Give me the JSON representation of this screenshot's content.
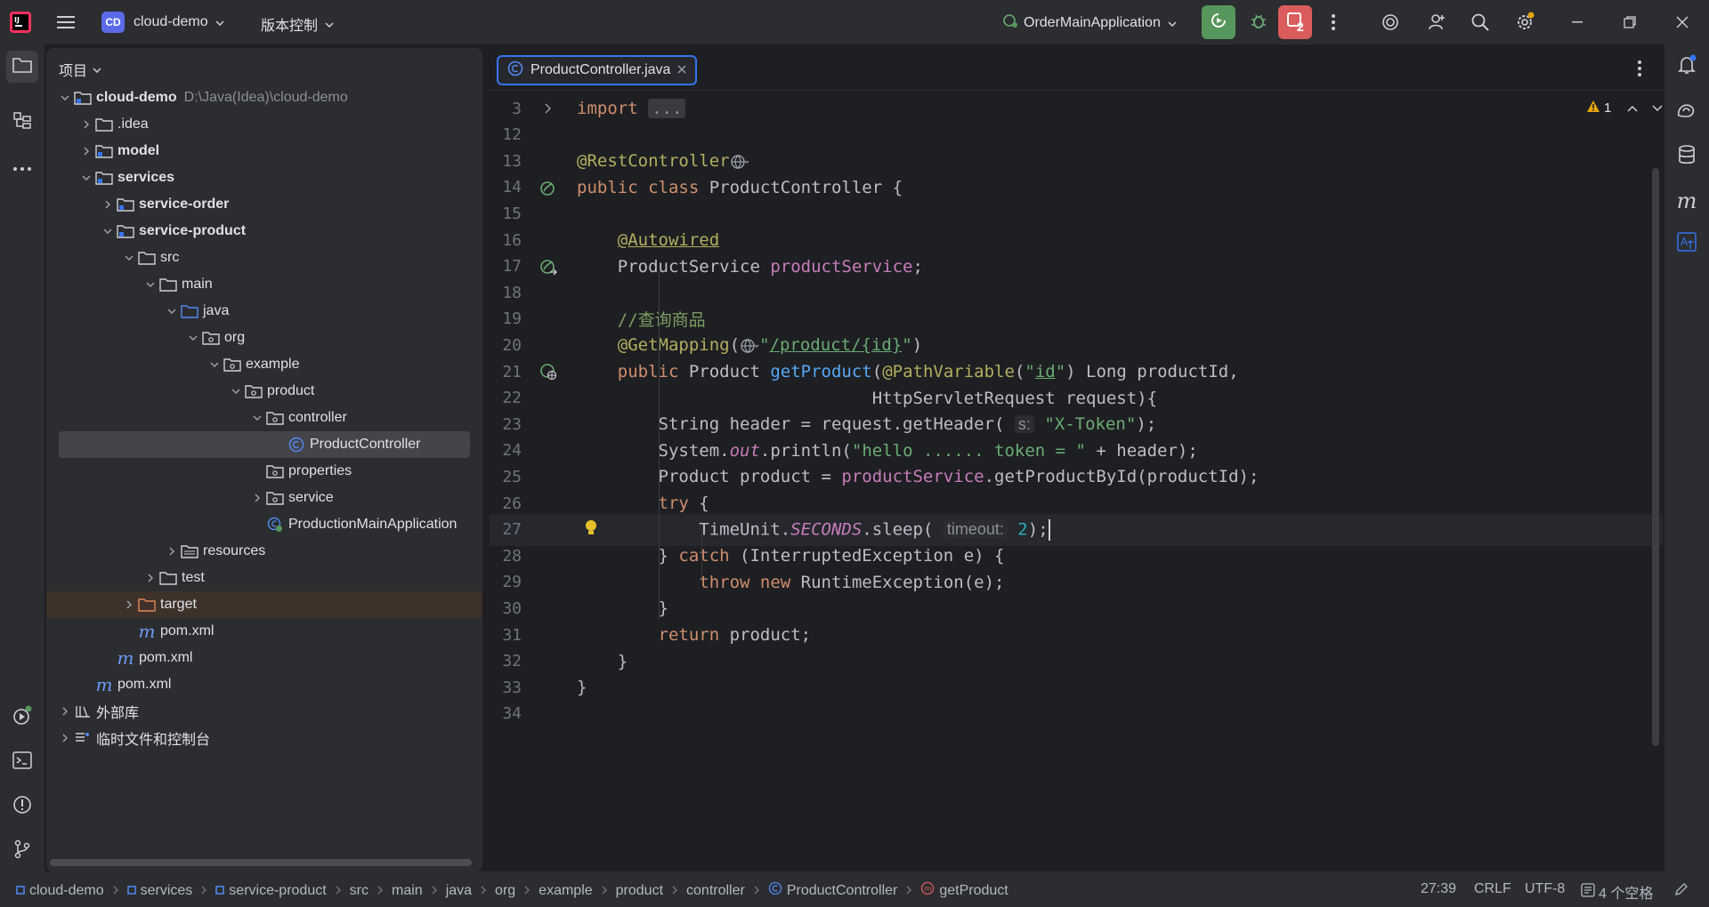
{
  "titlebar": {
    "project_badge": "CD",
    "project_name": "cloud-demo",
    "vcs_menu": "版本控制",
    "run_config": "OrderMainApplication",
    "run_badge_count": "2"
  },
  "project_panel": {
    "title": "项目",
    "tree": [
      {
        "label": "cloud-demo",
        "path": "D:\\Java(Idea)\\cloud-demo",
        "depth": 0,
        "chevron": "down",
        "icon": "module-folder",
        "bold": true
      },
      {
        "label": ".idea",
        "depth": 1,
        "chevron": "right",
        "icon": "folder"
      },
      {
        "label": "model",
        "depth": 1,
        "chevron": "right",
        "icon": "module-folder",
        "bold": true
      },
      {
        "label": "services",
        "depth": 1,
        "chevron": "down",
        "icon": "module-folder",
        "bold": true
      },
      {
        "label": "service-order",
        "depth": 2,
        "chevron": "right",
        "icon": "module-folder",
        "bold": true
      },
      {
        "label": "service-product",
        "depth": 2,
        "chevron": "down",
        "icon": "module-folder",
        "bold": true
      },
      {
        "label": "src",
        "depth": 3,
        "chevron": "down",
        "icon": "folder"
      },
      {
        "label": "main",
        "depth": 4,
        "chevron": "down",
        "icon": "folder"
      },
      {
        "label": "java",
        "depth": 5,
        "chevron": "down",
        "icon": "source-folder"
      },
      {
        "label": "org",
        "depth": 6,
        "chevron": "down",
        "icon": "package"
      },
      {
        "label": "example",
        "depth": 7,
        "chevron": "down",
        "icon": "package"
      },
      {
        "label": "product",
        "depth": 8,
        "chevron": "down",
        "icon": "package"
      },
      {
        "label": "controller",
        "depth": 9,
        "chevron": "down",
        "icon": "package"
      },
      {
        "label": "ProductController",
        "depth": 10,
        "chevron": "none",
        "icon": "class",
        "selected": true
      },
      {
        "label": "properties",
        "depth": 9,
        "chevron": "none",
        "icon": "package"
      },
      {
        "label": "service",
        "depth": 9,
        "chevron": "right",
        "icon": "package"
      },
      {
        "label": "ProductionMainApplication",
        "depth": 9,
        "chevron": "none",
        "icon": "spring-class"
      },
      {
        "label": "resources",
        "depth": 5,
        "chevron": "right",
        "icon": "resources-folder"
      },
      {
        "label": "test",
        "depth": 4,
        "chevron": "right",
        "icon": "folder"
      },
      {
        "label": "target",
        "depth": 3,
        "chevron": "right",
        "icon": "excluded-folder",
        "excluded": true
      },
      {
        "label": "pom.xml",
        "depth": 3,
        "chevron": "none",
        "icon": "maven"
      },
      {
        "label": "pom.xml",
        "depth": 2,
        "chevron": "none",
        "icon": "maven"
      },
      {
        "label": "pom.xml",
        "depth": 1,
        "chevron": "none",
        "icon": "maven"
      },
      {
        "label": "外部库",
        "depth": 0,
        "chevron": "right",
        "icon": "library"
      },
      {
        "label": "临时文件和控制台",
        "depth": 0,
        "chevron": "right",
        "icon": "scratches"
      }
    ]
  },
  "editor": {
    "tab_label": "ProductController.java",
    "warning_count": "1",
    "lines": [
      {
        "n": "3",
        "html": "<span class=\"kw\">import</span> <span class=\"fold-dots\">...</span>",
        "fold": true
      },
      {
        "n": "12",
        "html": ""
      },
      {
        "n": "13",
        "html": "<span class=\"ann\">@RestController</span><span class=\"g-globe\"></span>"
      },
      {
        "n": "14",
        "html": "<span class=\"kw\">public class</span> ProductController {",
        "gutter": "bean"
      },
      {
        "n": "15",
        "html": ""
      },
      {
        "n": "16",
        "html": "    <span class=\"ann uline\">@Autowired</span>"
      },
      {
        "n": "17",
        "html": "    ProductService <span class=\"fld\">productService</span>;",
        "gutter": "bean-arrow"
      },
      {
        "n": "18",
        "html": ""
      },
      {
        "n": "19",
        "html": "    <span class=\"cmt\">//查询商品</span>"
      },
      {
        "n": "20",
        "html": "    <span class=\"ann\">@GetMapping</span>(<span class=\"g-globe\"></span><span class=\"str\">\"<span class=\"uline\">/product/{id}</span>\"</span>)"
      },
      {
        "n": "21",
        "html": "    <span class=\"kw\">public</span> Product <span class=\"fn\">getProduct</span>(<span class=\"ann\">@PathVariable</span>(<span class=\"str\">\"<span class=\"uline\">id</span>\"</span>) Long productId,",
        "gutter": "web"
      },
      {
        "n": "22",
        "html": "                             HttpServletRequest request){"
      },
      {
        "n": "23",
        "html": "        String header = request.getHeader( <span class=\"hint\">s:</span> <span class=\"str\">\"X-Token\"</span>);"
      },
      {
        "n": "24",
        "html": "        System.<span class=\"static\">out</span>.println(<span class=\"str\">\"hello ...... token = \"</span> + header);"
      },
      {
        "n": "25",
        "html": "        Product product = <span class=\"fld\">productService</span>.getProductById(productId);"
      },
      {
        "n": "26",
        "html": "        <span class=\"kw\">try</span> {"
      },
      {
        "n": "27",
        "html": "            TimeUnit.<span class=\"static\">SECONDS</span>.sleep( <span class=\"hint\">timeout:</span> <span class=\"num\">2</span>);<span class=\"caret\"></span>",
        "current": true,
        "bulb": true
      },
      {
        "n": "28",
        "html": "        } <span class=\"kw\">catch</span> (InterruptedException e) {"
      },
      {
        "n": "29",
        "html": "            <span class=\"kw\">throw new</span> RuntimeException(e);"
      },
      {
        "n": "30",
        "html": "        }"
      },
      {
        "n": "31",
        "html": "        <span class=\"kw\">return</span> product;"
      },
      {
        "n": "32",
        "html": "    }"
      },
      {
        "n": "33",
        "html": "}"
      },
      {
        "n": "34",
        "html": ""
      }
    ]
  },
  "statusbar": {
    "breadcrumbs": [
      "cloud-demo",
      "services",
      "service-product",
      "src",
      "main",
      "java",
      "org",
      "example",
      "product",
      "controller",
      "ProductController",
      "getProduct"
    ],
    "position": "27:39",
    "line_sep": "CRLF",
    "encoding": "UTF-8",
    "indent": "4 个空格"
  },
  "colors": {
    "accent": "#3574f0",
    "run_green": "#57965c",
    "stop_red": "#db5c5c"
  }
}
